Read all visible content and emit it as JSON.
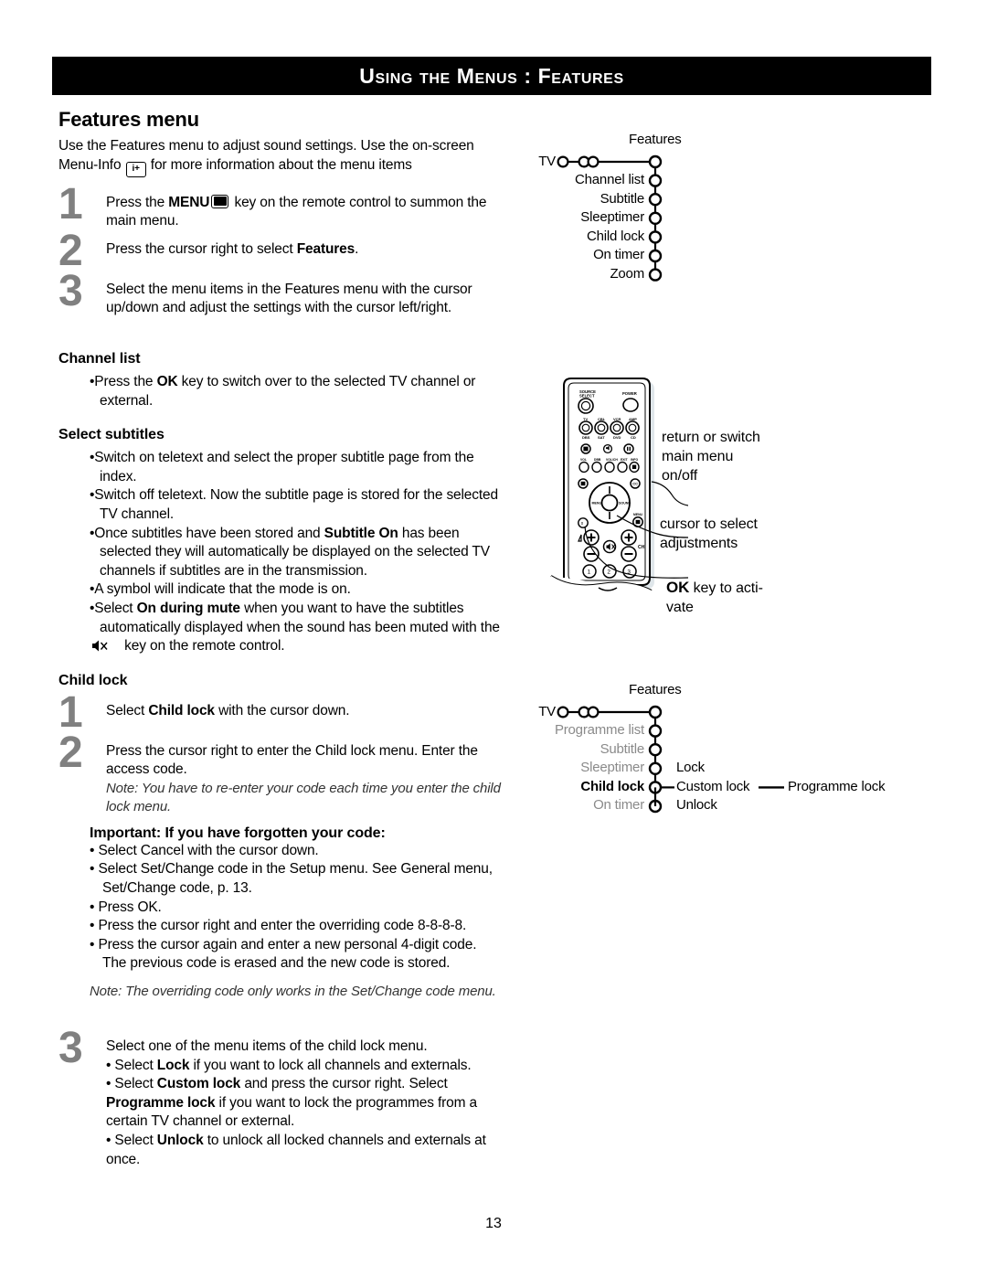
{
  "header": {
    "title": "Using the Menus : Features"
  },
  "page_number": "13",
  "features_section": {
    "heading": "Features menu",
    "intro_part1": "Use the Features menu to adjust sound settings.  Use the on-screen Menu-Info",
    "intro_icon": "i+",
    "intro_part2": "for more information about the menu items",
    "steps": [
      {
        "num": "1",
        "text_before_icon": "Press the ",
        "bold_label": "MENU",
        "icon": "menu-key-icon",
        "text_after_icon": " key on the remote control to summon the main menu."
      },
      {
        "num": "2",
        "text": "Press the cursor right to select ",
        "bold": "Features",
        "text_end": "."
      },
      {
        "num": "3",
        "text": "Select the menu items in the Features menu with the cursor up/down and adjust the settings with the cursor left/right."
      }
    ]
  },
  "channel_list": {
    "heading": "Channel list",
    "bullets": [
      {
        "pre": "Press the ",
        "bold": "OK",
        "post": " key to switch over to the selected TV channel or external."
      }
    ]
  },
  "select_subtitles": {
    "heading": "Select subtitles",
    "bullets": [
      {
        "pre": "Switch on teletext and select the proper subtitle page from the index.",
        "bold": "",
        "post": ""
      },
      {
        "pre": "Switch off teletext.  Now the subtitle page is stored for the selected TV channel.",
        "bold": "",
        "post": ""
      },
      {
        "pre": "Once subtitles have been stored and ",
        "bold": "Subtitle On",
        "post": " has been selected they will automatically be displayed on the selected TV channels if subtitles are in the transmission."
      },
      {
        "pre": "A symbol will indicate that the mode is on.",
        "bold": "",
        "post": ""
      },
      {
        "pre": "Select ",
        "bold": "On during mute",
        "post": " when you want to have the subtitles automatically displayed when the sound has been muted with the ",
        "icon": "mute-key-icon",
        "tail": " key on the remote control."
      }
    ]
  },
  "child_lock": {
    "heading": "Child lock",
    "step1": {
      "num": "1",
      "pre": "Select ",
      "bold": "Child lock",
      "post": " with the cursor down."
    },
    "step2": {
      "num": "2",
      "text": "Press the cursor right to enter the Child lock menu. Enter the access code.",
      "note": "Note: You have to re-enter your code each time you enter the child lock menu."
    },
    "important": {
      "heading": "Important: If you have forgotten your code:",
      "bullets": [
        "Select Cancel with the cursor down.",
        "Select Set/Change code in the Setup menu. See General menu, Set/Change code, p. 13.",
        "Press OK.",
        "Press the cursor right and enter the overriding code 8-8-8-8.",
        "Press the cursor again and enter a new personal 4-digit code. The previous code is erased and the new code is stored."
      ],
      "note": "Note: The overriding code only works in the Set/Change code menu."
    },
    "step3": {
      "num": "3",
      "line1": "Select one of the menu items of the child lock menu.",
      "bullet1_pre": "• Select ",
      "bullet1_bold": "Lock",
      "bullet1_post": " if you want to lock all channels and externals.",
      "bullet2_pre": "• Select ",
      "bullet2_bold": "Custom lock",
      "bullet2_mid": " and press the cursor right. Select ",
      "bullet2_bold2": "Programme lock",
      "bullet2_post": " if you want to lock the programmes from a certain TV channel or external.",
      "bullet3_pre": "•  Select ",
      "bullet3_bold": "Unlock",
      "bullet3_post": " to unlock all locked channels and externals at once."
    }
  },
  "menu_tree_top": {
    "title": "Features",
    "root_label": "TV",
    "items": [
      {
        "label": "Channel list",
        "dim": false
      },
      {
        "label": "Subtitle",
        "dim": false
      },
      {
        "label": "Sleeptimer",
        "dim": false
      },
      {
        "label": "Child lock",
        "dim": false
      },
      {
        "label": "On timer",
        "dim": false
      },
      {
        "label": "Zoom",
        "dim": false
      }
    ]
  },
  "menu_tree_bottom": {
    "title": "Features",
    "root_label": "TV",
    "items": [
      {
        "label": "Programme list",
        "dim": true
      },
      {
        "label": "Subtitle",
        "dim": true
      },
      {
        "label": "Sleeptimer",
        "dim": true
      },
      {
        "label": "Child lock",
        "dim": false
      },
      {
        "label": "On timer",
        "dim": true
      }
    ],
    "submenu": [
      {
        "label": "Lock"
      },
      {
        "label": "Custom lock"
      },
      {
        "label": "Unlock"
      }
    ],
    "sub_submenu": "Programme lock"
  },
  "remote_callouts": {
    "callout1": "return or switch\nmain menu\non/off",
    "callout2": "cursor to select\nadjustments",
    "callout3_bold": "OK",
    "callout3_rest": " key to acti-\nvate"
  },
  "remote_labels": {
    "source_select": "SOURCE SELECT",
    "power": "POWER",
    "row1": [
      "TV",
      "CBL",
      "VCR",
      "AMP"
    ],
    "row2": [
      "DBS",
      "SAT",
      "DVD",
      "CD"
    ],
    "numbers": [
      "1",
      "2",
      "3"
    ],
    "ch": "CH",
    "menu": "MENU"
  },
  "colors": {
    "header_bg": "#000000",
    "header_text": "#ffffff",
    "step_number": "#808080",
    "dim_text": "#8a8a8a",
    "body_text": "#000000"
  }
}
